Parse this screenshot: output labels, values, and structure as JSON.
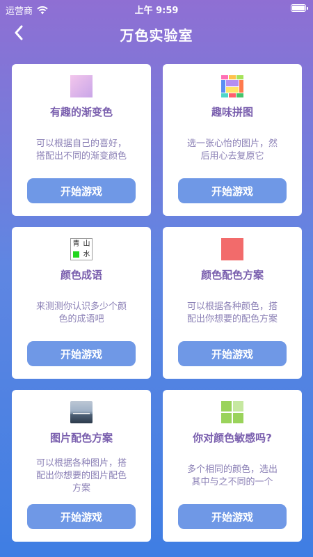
{
  "status_bar": {
    "carrier": "运营商",
    "time": "上午 9:59"
  },
  "nav": {
    "title": "万色实验室",
    "back_icon": "chevron-left-icon"
  },
  "cards": [
    {
      "title": "有趣的渐变色",
      "desc_lines": [
        "可以根据自己的喜好，",
        "搭配出不同的渐变颜色"
      ],
      "button": "开始游戏",
      "icon": "gradient-icon"
    },
    {
      "title": "趣味拼图",
      "desc_lines": [
        "选一张心怡的图片，然",
        "后用心去复原它"
      ],
      "button": "开始游戏",
      "icon": "puzzle-icon"
    },
    {
      "title": "颜色成语",
      "desc_lines": [
        "来测测你认识多少个颜",
        "色的成语吧"
      ],
      "button": "开始游戏",
      "icon": "idiom-icon",
      "icon_chars": [
        "青",
        "山",
        "水"
      ]
    },
    {
      "title": "颜色配色方案",
      "desc_lines": [
        "可以根据各种颜色，搭",
        "配出你想要的配色方案"
      ],
      "button": "开始游戏",
      "icon": "color-swatch-icon"
    },
    {
      "title": "图片配色方案",
      "desc_lines": [
        "可以根据各种图片，搭",
        "配出你想要的图片配色",
        "方案"
      ],
      "button": "开始游戏",
      "icon": "photo-icon"
    },
    {
      "title": "你对颜色敏感吗?",
      "desc_lines": [
        "多个相同的颜色，选出",
        "其中与之不同的一个"
      ],
      "button": "开始游戏",
      "icon": "color-blocks-icon"
    }
  ],
  "colors": {
    "accent_button": "#6f98e6",
    "title_text": "#7a5fae",
    "desc_text": "#8a7fb5",
    "bg_top": "#8f6fd3",
    "bg_bottom": "#3f7ee3"
  }
}
